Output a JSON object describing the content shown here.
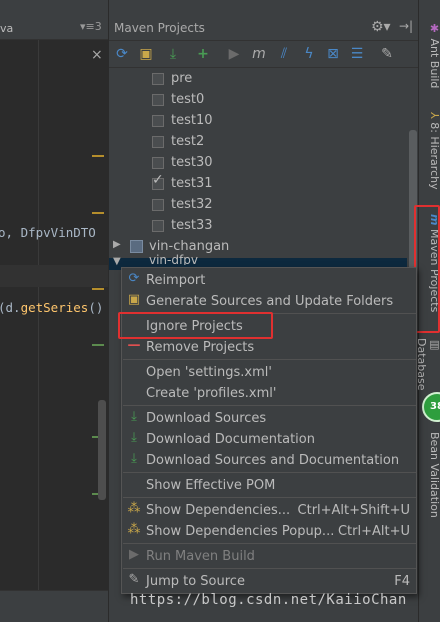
{
  "editor": {
    "tab_name": "va",
    "tab_menu": "▾≡3",
    "close": "×",
    "code_line1": "o, DfpvVinDTO",
    "code_line2_prefix": "(d.",
    "code_line2_fn": "getSeries",
    "code_line2_suffix": "()"
  },
  "maven": {
    "title": "Maven Projects",
    "toolbar": [
      "refresh-icon",
      "folder-add-icon",
      "download-icon",
      "plus-icon",
      "run-icon",
      "maven-icon",
      "toggle-offline-icon",
      "lightning-icon",
      "skip-tests-icon",
      "collapse-icon",
      "settings-icon"
    ],
    "profiles": [
      {
        "label": "pre",
        "checked": false
      },
      {
        "label": "test0",
        "checked": false
      },
      {
        "label": "test10",
        "checked": false
      },
      {
        "label": "test2",
        "checked": false
      },
      {
        "label": "test30",
        "checked": false
      },
      {
        "label": "test31",
        "checked": true
      },
      {
        "label": "test32",
        "checked": false
      },
      {
        "label": "test33",
        "checked": false
      }
    ],
    "modules": [
      {
        "label": "vin-changan"
      },
      {
        "label": "vin-dfpv"
      }
    ]
  },
  "context_menu": {
    "items": [
      {
        "label": "Reimport",
        "shortcut": "",
        "icon": "reimport-icon",
        "disabled": false
      },
      {
        "label": "Generate Sources and Update Folders",
        "shortcut": "",
        "icon": "generate-icon",
        "disabled": false
      },
      {
        "label": "Ignore Projects",
        "shortcut": "",
        "icon": "",
        "disabled": false
      },
      {
        "label": "Remove Projects",
        "shortcut": "",
        "icon": "remove-icon",
        "disabled": false
      },
      {
        "label": "Open 'settings.xml'",
        "shortcut": "",
        "icon": "",
        "disabled": false
      },
      {
        "label": "Create 'profiles.xml'",
        "shortcut": "",
        "icon": "",
        "disabled": false
      },
      {
        "label": "Download Sources",
        "shortcut": "",
        "icon": "download-icon",
        "disabled": false
      },
      {
        "label": "Download Documentation",
        "shortcut": "",
        "icon": "download-icon",
        "disabled": false
      },
      {
        "label": "Download Sources and Documentation",
        "shortcut": "",
        "icon": "download-icon",
        "disabled": false
      },
      {
        "label": "Show Effective POM",
        "shortcut": "",
        "icon": "",
        "disabled": false
      },
      {
        "label": "Show Dependencies...",
        "shortcut": "Ctrl+Alt+Shift+U",
        "icon": "dependencies-icon",
        "disabled": false
      },
      {
        "label": "Show Dependencies Popup...",
        "shortcut": "Ctrl+Alt+U",
        "icon": "dependencies-icon",
        "disabled": false
      },
      {
        "label": "Run Maven Build",
        "shortcut": "",
        "icon": "run-icon",
        "disabled": true
      },
      {
        "label": "Jump to Source",
        "shortcut": "F4",
        "icon": "jump-icon",
        "disabled": false
      }
    ]
  },
  "side_tabs": {
    "ant_build": "Ant Build",
    "hierarchy": "8: Hierarchy",
    "maven_projects": "Maven Projects",
    "database": "Database",
    "bean_validation": "Bean Validation",
    "badge": "38"
  },
  "watermark": "https://blog.csdn.net/KaiioChan",
  "colors": {
    "highlight_box": "#e03030",
    "accent_blue": "#4a88c7",
    "green": "#499c54"
  }
}
